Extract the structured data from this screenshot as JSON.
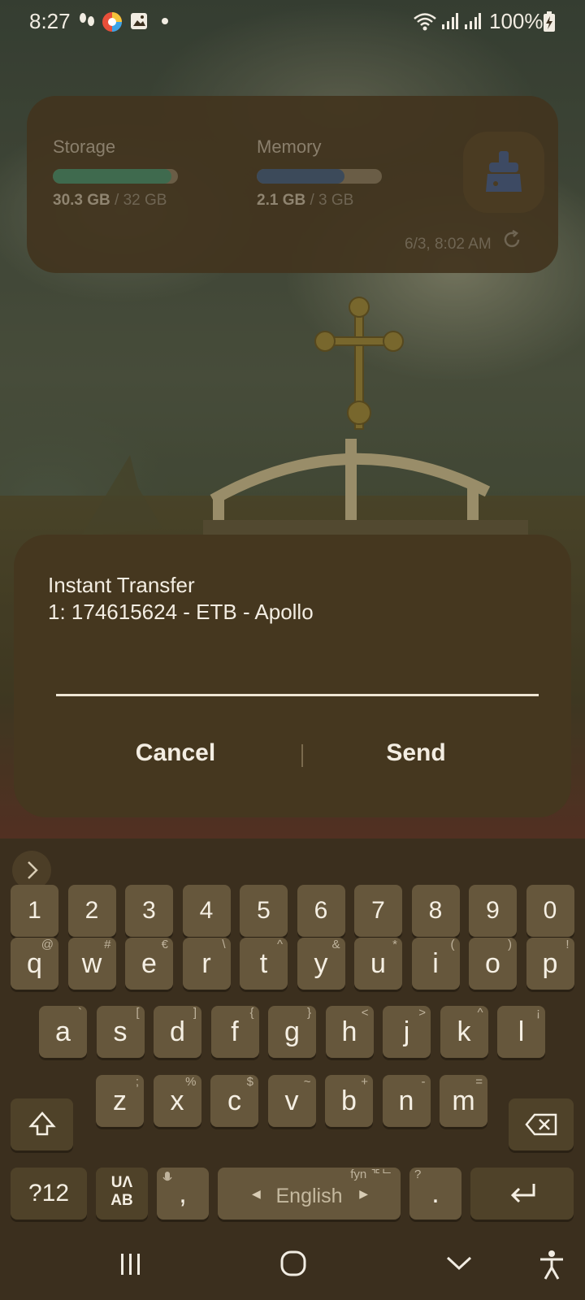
{
  "status_bar": {
    "time": "8:27",
    "battery": "100%"
  },
  "widget": {
    "storage_label": "Storage",
    "storage_used": "30.3 GB",
    "storage_total": " / 32 GB",
    "storage_fraction": 0.95,
    "memory_label": "Memory",
    "memory_used": "2.1 GB",
    "memory_total": " / 3 GB",
    "memory_fraction": 0.7,
    "updated": "6/3, 8:02 AM"
  },
  "dialog": {
    "line1": "Instant Transfer",
    "line2": "1: 174615624 - ETB - Apollo",
    "input_value": "",
    "cancel": "Cancel",
    "send": "Send"
  },
  "keyboard": {
    "numbers": [
      "1",
      "2",
      "3",
      "4",
      "5",
      "6",
      "7",
      "8",
      "9",
      "0"
    ],
    "row1": [
      {
        "k": "q",
        "h": "@"
      },
      {
        "k": "w",
        "h": "#"
      },
      {
        "k": "e",
        "h": "€"
      },
      {
        "k": "r",
        "h": "\\"
      },
      {
        "k": "t",
        "h": "^"
      },
      {
        "k": "y",
        "h": "&"
      },
      {
        "k": "u",
        "h": "*"
      },
      {
        "k": "i",
        "h": "("
      },
      {
        "k": "o",
        "h": ")"
      },
      {
        "k": "p",
        "h": "!"
      }
    ],
    "row2": [
      {
        "k": "a",
        "h": "`"
      },
      {
        "k": "s",
        "h": "["
      },
      {
        "k": "d",
        "h": "]"
      },
      {
        "k": "f",
        "h": "{"
      },
      {
        "k": "g",
        "h": "}"
      },
      {
        "k": "h",
        "h": "<"
      },
      {
        "k": "j",
        "h": ">"
      },
      {
        "k": "k",
        "h": "^"
      },
      {
        "k": "l",
        "h": "¡"
      }
    ],
    "row3": [
      {
        "k": "z",
        "h": ";"
      },
      {
        "k": "x",
        "h": "%"
      },
      {
        "k": "c",
        "h": "$"
      },
      {
        "k": "v",
        "h": "~"
      },
      {
        "k": "b",
        "h": "+"
      },
      {
        "k": "n",
        "h": "-"
      },
      {
        "k": "m",
        "h": "="
      }
    ],
    "symbols_key": "?12",
    "lang_switch_top": "UΛ",
    "lang_switch_bottom": "AB",
    "comma": ",",
    "space_label": "English",
    "space_hint": "fyn ᄀᄃᄂ",
    "period": ".",
    "period_hint": "?"
  },
  "icons": {
    "wifi": "wifi-icon",
    "signal": "signal-icon",
    "battery": "battery-charging-icon",
    "cleaner": "broom-icon",
    "refresh": "refresh-icon",
    "expand": "chevron-right-icon",
    "shift": "shift-icon",
    "backspace": "backspace-icon",
    "mic": "mic-icon",
    "enter": "enter-icon",
    "recents": "recents-icon",
    "home": "home-icon",
    "hide_keyboard": "chevron-down-icon",
    "accessibility": "accessibility-icon"
  },
  "colors": {
    "storage_bar": "#3f6a4e",
    "memory_bar": "#3c4a5a",
    "dialog_bg": "#45371f",
    "keyboard_bg": "#3b2f1e"
  }
}
